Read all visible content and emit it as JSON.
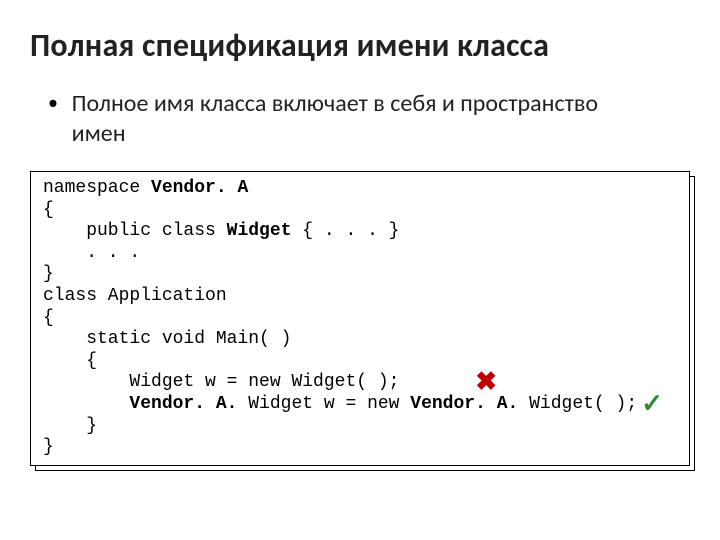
{
  "title": "Полная спецификация имени класса",
  "bullet": "Полное имя класса включает в себя и пространство имен",
  "code": {
    "l1a": "namespace ",
    "l1b": "Vendor. A",
    "l2": "{",
    "l3a": "    public class ",
    "l3b": "Widget",
    "l3c": " { . . . }",
    "l4": "    . . .",
    "l5": "}",
    "l6": "class Application",
    "l7": "{",
    "l8": "    static void Main( )",
    "l9": "    {",
    "l10": "        Widget w = new Widget( );",
    "l11a": "        ",
    "l11b": "Vendor. A.",
    "l11c": " Widget w = new ",
    "l11d": "Vendor. A.",
    "l11e": " Widget( );",
    "l12": "    }",
    "l13": "}"
  },
  "marks": {
    "x": "✖",
    "check": "✓"
  }
}
